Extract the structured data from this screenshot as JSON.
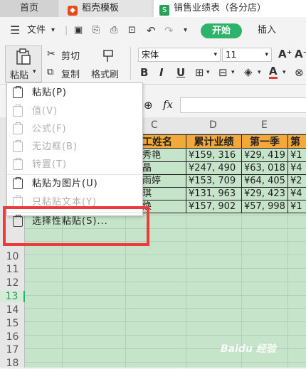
{
  "tabs": [
    {
      "label": "首页"
    },
    {
      "label": "稻壳模板",
      "icon": "docer-logo-icon"
    },
    {
      "label": "销售业绩表（各分店）",
      "icon": "spreadsheet-logo-icon"
    }
  ],
  "menu": {
    "hamburger_icon": "menu-icon",
    "file_label": "文件",
    "start_label": "开始",
    "insert_label": "插入"
  },
  "ribbon": {
    "paste_label": "粘贴",
    "cut_label": "剪切",
    "copy_label": "复制",
    "format_painter_label": "格式刷",
    "font_name": "宋体",
    "font_size": "11",
    "bold": "B",
    "italic": "I",
    "underline": "U",
    "grow_font": "A⁺",
    "shrink_font": "A⁻"
  },
  "formula_bar": {
    "fx_label": "fx",
    "value": ""
  },
  "columns": [
    "C",
    "D",
    "E"
  ],
  "rows": [
    "10",
    "11",
    "12",
    "13",
    "14",
    "15",
    "16",
    "17",
    "18"
  ],
  "active_row": "13",
  "table": {
    "headers": [
      "工姓名",
      "累计业绩",
      "第一季",
      "第"
    ],
    "rows": [
      [
        "秀艳",
        "¥159, 316",
        "¥29, 419",
        "¥1"
      ],
      [
        "晶",
        "¥247, 490",
        "¥63, 018",
        "¥4"
      ],
      [
        "雨婷",
        "¥153, 709",
        "¥64, 405",
        "¥2"
      ],
      [
        "琪",
        "¥131, 963",
        "¥29, 423",
        "¥4"
      ],
      [
        "焕",
        "¥157, 902",
        "¥57, 998",
        "¥1"
      ]
    ]
  },
  "paste_menu": {
    "items": [
      {
        "label": "粘贴(P)",
        "enabled": true
      },
      {
        "label": "值(V)",
        "enabled": false
      },
      {
        "label": "公式(F)",
        "enabled": false
      },
      {
        "label": "无边框(B)",
        "enabled": false
      },
      {
        "label": "转置(T)",
        "enabled": false
      },
      {
        "label": "粘贴为图片(U)",
        "enabled": true
      },
      {
        "label": "只粘贴文本(Y)",
        "enabled": false
      },
      {
        "label": "选择性粘贴(S)...",
        "enabled": true,
        "highlighted": true
      }
    ]
  },
  "watermark": "Baidu 经验",
  "colors": {
    "accent": "#2db46a",
    "header_fill": "#f3a83a",
    "grid_fill": "#c6e4c9",
    "highlight": "#ee3a3a"
  }
}
